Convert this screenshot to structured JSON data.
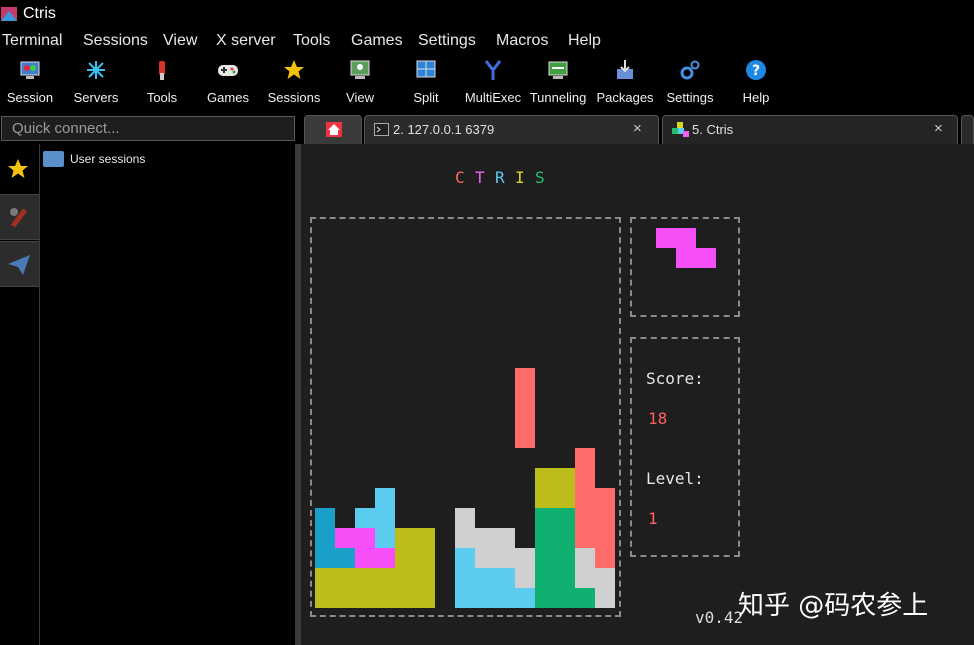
{
  "window": {
    "title": "Ctris"
  },
  "menu": [
    "Terminal",
    "Sessions",
    "View",
    "X server",
    "Tools",
    "Games",
    "Settings",
    "Macros",
    "Help"
  ],
  "toolbar": [
    {
      "label": "Session",
      "icon": "session-icon"
    },
    {
      "label": "Servers",
      "icon": "servers-icon"
    },
    {
      "label": "Tools",
      "icon": "tools-icon"
    },
    {
      "label": "Games",
      "icon": "gamepad-icon"
    },
    {
      "label": "Sessions",
      "icon": "star-icon"
    },
    {
      "label": "View",
      "icon": "view-icon"
    },
    {
      "label": "Split",
      "icon": "split-icon"
    },
    {
      "label": "MultiExec",
      "icon": "multiexec-icon"
    },
    {
      "label": "Tunneling",
      "icon": "tunneling-icon"
    },
    {
      "label": "Packages",
      "icon": "packages-icon"
    },
    {
      "label": "Settings",
      "icon": "gears-icon"
    },
    {
      "label": "Help",
      "icon": "help-icon"
    }
  ],
  "quick_connect": {
    "placeholder": "Quick connect..."
  },
  "tabs": [
    {
      "label": "",
      "icon": "home-icon"
    },
    {
      "label": "2. 127.0.0.1 6379",
      "icon": "terminal-icon",
      "close": "×"
    },
    {
      "label": "5. Ctris",
      "icon": "ctris-icon",
      "close": "×"
    }
  ],
  "sidebar": {
    "user_sessions": "User sessions"
  },
  "game": {
    "title_letters": [
      "C",
      "T",
      "R",
      "I",
      "S"
    ],
    "title_colors": [
      "#ff6a6a",
      "#f25ff2",
      "#5dc8f0",
      "#d8d820",
      "#20c070"
    ],
    "score_label": "Score:",
    "score": "18",
    "level_label": "Level:",
    "level": "1",
    "version": "v0.42"
  },
  "watermark": "知乎 @码农参上",
  "colors": {
    "red": "#ff6a6a",
    "magenta": "#f74ff7",
    "cyan": "#5bcbef",
    "teal": "#1aa0c8",
    "olive": "#bcbc1a",
    "green": "#10b070",
    "grey": "#d0d0d0"
  }
}
